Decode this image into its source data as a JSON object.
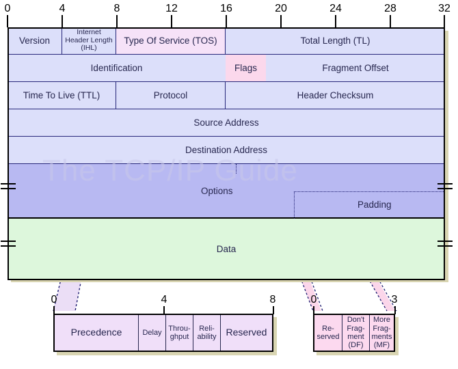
{
  "diagram": {
    "watermark": "The TCP/IP Guide",
    "bit_ruler_top": [
      "0",
      "4",
      "8",
      "12",
      "16",
      "20",
      "24",
      "28",
      "32"
    ],
    "header_rows": [
      {
        "row": 1,
        "fields": [
          {
            "label": "Version",
            "bits": "0-4",
            "fill": "header"
          },
          {
            "label": "Internet Header Length (IHL)",
            "bits": "4-8",
            "fill": "header"
          },
          {
            "label": "Type Of Service (TOS)",
            "bits": "8-16",
            "fill": "tos"
          },
          {
            "label": "Total Length (TL)",
            "bits": "16-32",
            "fill": "header"
          }
        ]
      },
      {
        "row": 2,
        "fields": [
          {
            "label": "Identification",
            "bits": "0-16",
            "fill": "header"
          },
          {
            "label": "Flags",
            "bits": "16-19",
            "fill": "flags"
          },
          {
            "label": "Fragment Offset",
            "bits": "19-32",
            "fill": "header"
          }
        ]
      },
      {
        "row": 3,
        "fields": [
          {
            "label": "Time To Live (TTL)",
            "bits": "0-8",
            "fill": "header"
          },
          {
            "label": "Protocol",
            "bits": "8-16",
            "fill": "header"
          },
          {
            "label": "Header Checksum",
            "bits": "16-32",
            "fill": "header"
          }
        ]
      },
      {
        "row": 4,
        "fields": [
          {
            "label": "Source Address",
            "bits": "0-32",
            "fill": "header"
          }
        ]
      },
      {
        "row": 5,
        "fields": [
          {
            "label": "Destination Address",
            "bits": "0-32",
            "fill": "header"
          }
        ]
      },
      {
        "row": 6,
        "fields": [
          {
            "label": "Options",
            "bits": "0-?",
            "fill": "options"
          },
          {
            "label": "Padding",
            "bits": "?-32",
            "fill": "options"
          }
        ]
      },
      {
        "row": 7,
        "fields": [
          {
            "label": "Data",
            "bits": "0-32",
            "fill": "data"
          }
        ]
      }
    ],
    "tos_detail": {
      "title_field": "Type Of Service (TOS)",
      "bit_ruler": [
        "0",
        "4",
        "8"
      ],
      "subfields": [
        {
          "label": "Precedence",
          "bits": 3
        },
        {
          "label": "Delay",
          "bits": 1
        },
        {
          "label": "Through-\nghput",
          "line1": "Throu-",
          "line2": "ghput",
          "bits": 1
        },
        {
          "label": "Reli-\nability",
          "line1": "Reli-",
          "line2": "ability",
          "bits": 1
        },
        {
          "label": "Reserved",
          "bits": 2
        }
      ]
    },
    "flags_detail": {
      "title_field": "Flags",
      "bit_ruler": [
        "0",
        "3"
      ],
      "subfields": [
        {
          "line1": "Re-",
          "line2": "served",
          "line3": "",
          "line4": ""
        },
        {
          "line1": "Don't",
          "line2": "Frag-",
          "line3": "ment",
          "line4": "(DF)"
        },
        {
          "line1": "More",
          "line2": "Frag-",
          "line3": "ments",
          "line4": "(MF)"
        }
      ]
    },
    "colors": {
      "header_fill": "#dcdffa",
      "tos_fill": "#f6e2f8",
      "flags_fill": "#fbd8ec",
      "options_fill": "#b8b9f2",
      "data_fill": "#ddf7dc",
      "ribbon_tos": "#e8d8f5",
      "ribbon_flags": "#fbd4e9",
      "border": "#000000",
      "shadow": "#d9d5b2",
      "watermark": "#c9c9ea"
    }
  }
}
